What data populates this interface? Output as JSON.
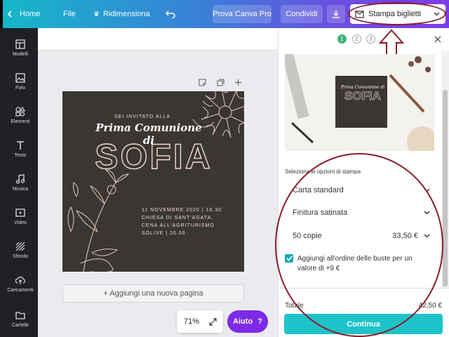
{
  "topbar": {
    "home": "Home",
    "file": "File",
    "resize": "Ridimensiona",
    "try_pro": "Prova Canva Pro",
    "share": "Condividi",
    "print": "Stampa biglietti"
  },
  "sidebar": {
    "items": [
      {
        "label": "Modelli",
        "icon": "layout-icon"
      },
      {
        "label": "Foto",
        "icon": "photo-icon"
      },
      {
        "label": "Elementi",
        "icon": "shapes-icon"
      },
      {
        "label": "Testo",
        "icon": "text-icon"
      },
      {
        "label": "Musica",
        "icon": "music-icon"
      },
      {
        "label": "Video",
        "icon": "video-icon"
      },
      {
        "label": "Sfondo",
        "icon": "background-icon"
      },
      {
        "label": "Caricamenti",
        "icon": "upload-icon"
      },
      {
        "label": "Cartelle",
        "icon": "folder-icon"
      }
    ]
  },
  "design": {
    "line1": "SEI INVITATO ALLA",
    "line2": "Prima Comunione di",
    "name": "SOFIA",
    "details": [
      "11 NOVEMBRE 2020 | 18.30",
      "CHIESA DI SANT'AGATA,",
      "CENA ALL'AGRITURISMO",
      "SOLIVE | 20.00"
    ]
  },
  "canvas": {
    "add_page": "+ Aggiungi una nuova pagina",
    "zoom": "71%",
    "help": "Aiuto",
    "help_mark": "?"
  },
  "panel": {
    "steps": [
      "1",
      "2",
      "3"
    ],
    "preview_text": {
      "line": "Prima Comunione di",
      "name": "SOFIA"
    },
    "section_title": "Seleziona le opzioni di stampa",
    "paper": "Carta standard",
    "finish": "Finitura satinata",
    "copies": "50 copie",
    "price": "33,50 €",
    "envelopes": "Aggiungi all'ordine delle buste per un valore di +9 €",
    "total_label": "Totale",
    "total_value": "42,50 €",
    "continue": "Continua"
  },
  "colors": {
    "accent": "#7d2ae8",
    "teal": "#1ec3c9",
    "annotation": "#8a1c2a",
    "design_bg": "#3a3634",
    "design_text": "#f2d8c8"
  }
}
